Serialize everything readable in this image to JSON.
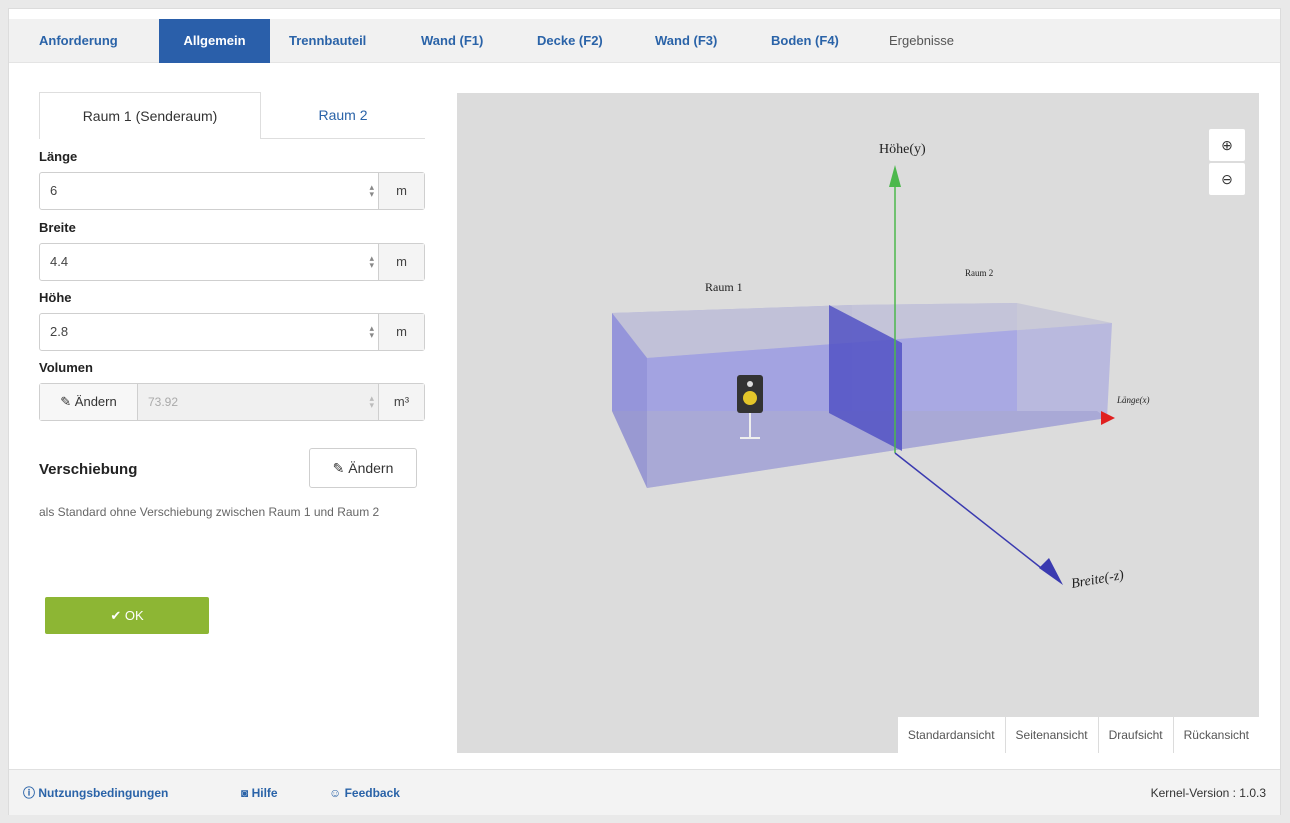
{
  "tabs": [
    {
      "label": "Anforderung"
    },
    {
      "label": "Allgemein"
    },
    {
      "label": "Trennbauteil"
    },
    {
      "label": "Wand (F1)"
    },
    {
      "label": "Decke (F2)"
    },
    {
      "label": "Wand (F3)"
    },
    {
      "label": "Boden (F4)"
    },
    {
      "label": "Ergebnisse"
    }
  ],
  "room_tabs": [
    "Raum 1 (Senderaum)",
    "Raum 2"
  ],
  "form": {
    "laenge": {
      "label": "Länge",
      "value": "6",
      "unit": "m"
    },
    "breite": {
      "label": "Breite",
      "value": "4.4",
      "unit": "m"
    },
    "hoehe": {
      "label": "Höhe",
      "value": "2.8",
      "unit": "m"
    },
    "volumen": {
      "label": "Volumen",
      "button": "Ändern",
      "value": "73.92",
      "unit": "m³"
    }
  },
  "verschiebung": {
    "title": "Verschiebung",
    "button": "Ändern",
    "description": "als Standard ohne Verschiebung zwischen Raum 1 und Raum 2"
  },
  "ok_button": "✔ OK",
  "viewer": {
    "axis_y": "Höhe(y)",
    "axis_z": "Breite(-z)",
    "axis_x": "Länge(x)",
    "room1": "Raum 1",
    "room2": "Raum 2",
    "views": [
      "Standardansicht",
      "Seitenansicht",
      "Draufsicht",
      "Rückansicht"
    ]
  },
  "footer": {
    "links": [
      "Nutzungsbedingungen",
      "Hilfe",
      "Feedback"
    ],
    "version": "Kernel-Version : 1.0.3"
  },
  "colors": {
    "accent": "#2a5faa",
    "ok": "#8db634",
    "room": "#8f8fd8"
  }
}
